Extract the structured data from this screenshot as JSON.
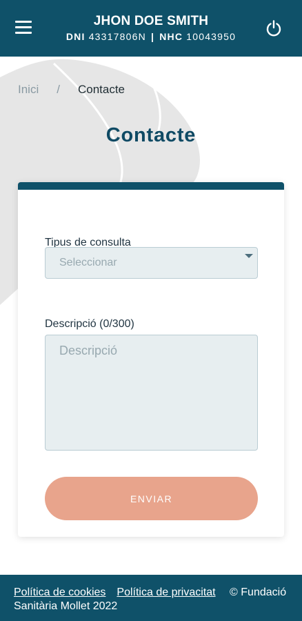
{
  "header": {
    "name": "JHON DOE SMITH",
    "dni_label": "DNI",
    "dni_value": "43317806N",
    "separator": "|",
    "nhc_label": "NHC",
    "nhc_value": "10043950"
  },
  "breadcrumb": {
    "home": "Inici",
    "separator": "/",
    "current": "Contacte"
  },
  "page": {
    "title": "Contacte"
  },
  "form": {
    "type_label": "Tipus de consulta",
    "type_placeholder": "Seleccionar",
    "description_label": "Descripció (0/300)",
    "description_placeholder": "Descripció",
    "submit_label": "ENVIAR"
  },
  "footer": {
    "cookies_link": "Política de cookies",
    "privacy_link": "Política de privacitat",
    "copyright": "© Fundació Sanitària Mollet 2022"
  },
  "colors": {
    "primary": "#0f5169",
    "accent_button": "#e8a48c",
    "field_bg": "#e7eef0"
  },
  "icons": {
    "menu": "hamburger-menu-icon",
    "power": "power-icon",
    "select": "caret-down-icon"
  }
}
